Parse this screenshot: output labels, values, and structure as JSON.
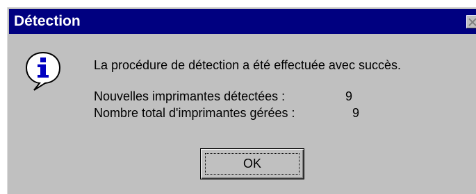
{
  "dialog": {
    "title": "Détection",
    "close_icon": "close-icon",
    "icon": "info-icon",
    "message": "La procédure de détection a été effectuée avec succès.",
    "stats": [
      {
        "label": "Nouvelles imprimantes détectées :",
        "value": "9"
      },
      {
        "label": "Nombre total d'imprimantes gérées :",
        "value": "9"
      }
    ],
    "ok_label": "OK"
  },
  "colors": {
    "titlebar": "#000080",
    "face": "#c0c0c0",
    "title_text": "#ffffff"
  }
}
